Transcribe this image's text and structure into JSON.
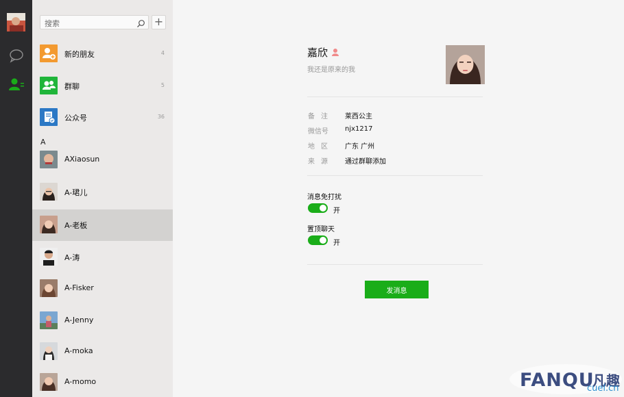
{
  "sidebar": {
    "search_placeholder": "搜索",
    "special_items": [
      {
        "label": "新的朋友",
        "count": "4",
        "color": "#f39a30"
      },
      {
        "label": "群聊",
        "count": "5",
        "color": "#20b53a"
      },
      {
        "label": "公众号",
        "count": "36",
        "color": "#2b78c5"
      }
    ],
    "section_letter": "A",
    "contacts": [
      {
        "name": "AXiaosun"
      },
      {
        "name": "A-珺儿"
      },
      {
        "name": "A-老板"
      },
      {
        "name": "A-涛"
      },
      {
        "name": "A-Fisker"
      },
      {
        "name": "A-Jenny"
      },
      {
        "name": "A-moka"
      },
      {
        "name": "A-momo"
      }
    ],
    "active_contact": "A-老板"
  },
  "profile": {
    "name": "嘉欣",
    "signature": "我还是原来的我",
    "fields": [
      {
        "key": "备注",
        "value": "莱西公主"
      },
      {
        "key": "微信号",
        "value": "njx1217"
      },
      {
        "key": "地区",
        "value": "广东 广州"
      },
      {
        "key": "来源",
        "value": "通过群聊添加"
      }
    ],
    "settings": [
      {
        "title": "消息免打扰",
        "state": "开"
      },
      {
        "title": "置顶聊天",
        "state": "开"
      }
    ],
    "send_button": "发消息"
  },
  "colors": {
    "nav_bg": "#2b2b2d",
    "list_bg": "#ebe9e8",
    "active_row": "#d3d2d0",
    "accent_green": "#1aad19"
  },
  "watermark": {
    "brand": "FANQU",
    "brand_cn": "凡趣",
    "url": "cuel.cn"
  }
}
